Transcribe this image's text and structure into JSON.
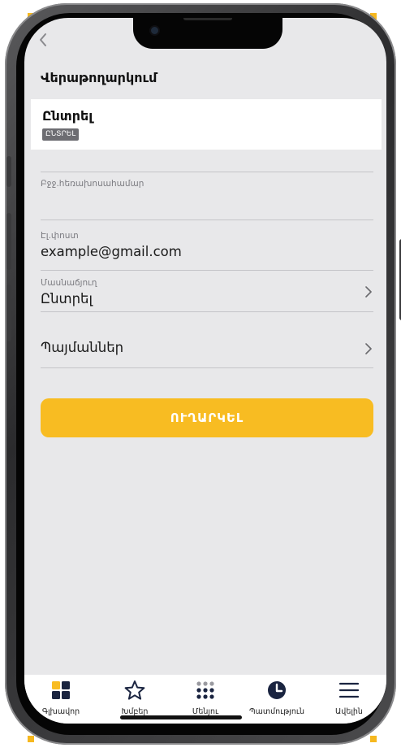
{
  "header": {
    "title": "Վերաթողարկում"
  },
  "select_card": {
    "title": "Ընտրել",
    "badge": "ԸՆՏՐԵԼ"
  },
  "form": {
    "phone": {
      "label": "Բջջ.հեռախոսահամար",
      "value": ""
    },
    "email": {
      "label": "Էլ.փոստ",
      "value": "example@gmail.com"
    },
    "branch": {
      "label": "Մասնաճյուղ",
      "value": "Ընտրել"
    },
    "terms": {
      "label": "Պայմաններ"
    },
    "submit_label": "ՈՒՂԱՐԿԵԼ"
  },
  "tabbar": {
    "items": [
      {
        "label": "Գլխավոր",
        "icon": "home-grid-icon"
      },
      {
        "label": "Խմբեր",
        "icon": "star-icon"
      },
      {
        "label": "Մենյու",
        "icon": "dots-grid-icon"
      },
      {
        "label": "Պատմություն",
        "icon": "history-clock-icon"
      },
      {
        "label": "Ավելին",
        "icon": "menu-lines-icon"
      }
    ]
  },
  "colors": {
    "accent": "#f8bc22",
    "screen_bg": "#e8e8ea",
    "badge_bg": "#6d6d72"
  }
}
